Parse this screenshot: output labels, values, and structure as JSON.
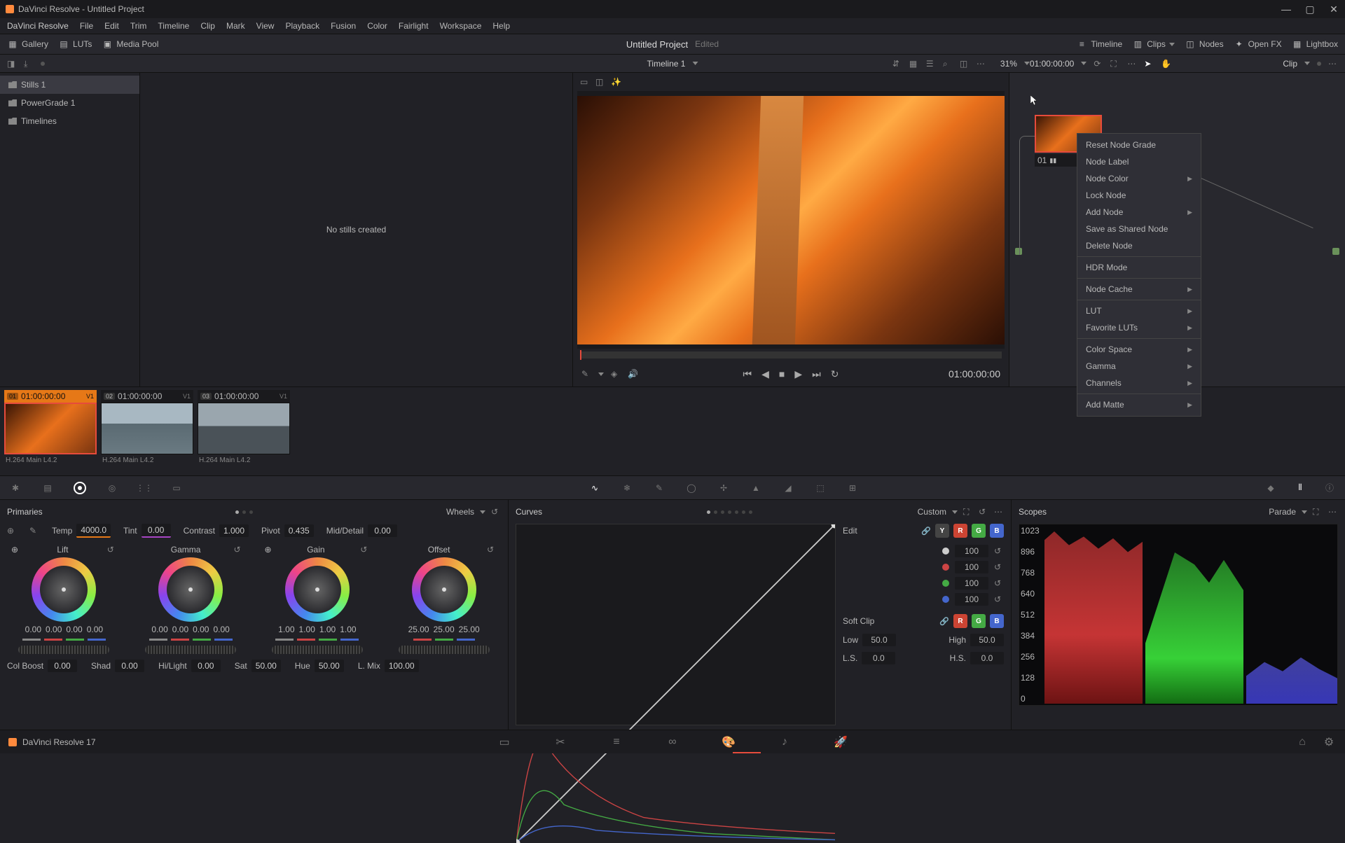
{
  "app": {
    "title": "DaVinci Resolve - Untitled Project",
    "version": "DaVinci Resolve 17"
  },
  "menu": [
    "DaVinci Resolve",
    "File",
    "Edit",
    "Trim",
    "Timeline",
    "Clip",
    "Mark",
    "View",
    "Playback",
    "Fusion",
    "Color",
    "Fairlight",
    "Workspace",
    "Help"
  ],
  "topbar": {
    "gallery": "Gallery",
    "luts": "LUTs",
    "mediapool": "Media Pool",
    "project": "Untitled Project",
    "edited": "Edited",
    "timeline": "Timeline",
    "clips": "Clips",
    "nodes": "Nodes",
    "openfx": "Open FX",
    "lightbox": "Lightbox"
  },
  "secbar": {
    "zoom": "31%",
    "timeline_name": "Timeline 1",
    "timecode": "01:00:00:00",
    "clip_label": "Clip"
  },
  "gallery": {
    "items": [
      "Stills 1",
      "PowerGrade 1",
      "Timelines"
    ],
    "empty": "No stills created"
  },
  "viewer": {
    "timecode": "01:00:00:00"
  },
  "node": {
    "num": "01"
  },
  "context_menu": {
    "reset": "Reset Node Grade",
    "label": "Node Label",
    "color": "Node Color",
    "lock": "Lock Node",
    "add": "Add Node",
    "save_shared": "Save as Shared Node",
    "delete": "Delete Node",
    "hdr": "HDR Mode",
    "cache": "Node Cache",
    "lut": "LUT",
    "fav_luts": "Favorite LUTs",
    "cspace": "Color Space",
    "gamma": "Gamma",
    "channels": "Channels",
    "matte": "Add Matte"
  },
  "clips": [
    {
      "num": "01",
      "tc": "01:00:00:00",
      "track": "V1",
      "codec": "H.264 Main L4.2",
      "selected": true,
      "style": "orange"
    },
    {
      "num": "02",
      "tc": "01:00:00:00",
      "track": "V1",
      "codec": "H.264 Main L4.2",
      "selected": false,
      "style": "lake"
    },
    {
      "num": "03",
      "tc": "01:00:00:00",
      "track": "V1",
      "codec": "H.264 Main L4.2",
      "selected": false,
      "style": "coast"
    }
  ],
  "primaries": {
    "title": "Primaries",
    "mode": "Wheels",
    "temp_l": "Temp",
    "temp": "4000.0",
    "tint_l": "Tint",
    "tint": "0.00",
    "contrast_l": "Contrast",
    "contrast": "1.000",
    "pivot_l": "Pivot",
    "pivot": "0.435",
    "middetail_l": "Mid/Detail",
    "middetail": "0.00",
    "wheels": [
      {
        "name": "Lift",
        "vals": [
          "0.00",
          "0.00",
          "0.00",
          "0.00"
        ]
      },
      {
        "name": "Gamma",
        "vals": [
          "0.00",
          "0.00",
          "0.00",
          "0.00"
        ]
      },
      {
        "name": "Gain",
        "vals": [
          "1.00",
          "1.00",
          "1.00",
          "1.00"
        ]
      },
      {
        "name": "Offset",
        "vals": [
          "25.00",
          "25.00",
          "25.00"
        ]
      }
    ],
    "colboost_l": "Col Boost",
    "colboost": "0.00",
    "shad_l": "Shad",
    "shad": "0.00",
    "hilight_l": "Hi/Light",
    "hilight": "0.00",
    "sat_l": "Sat",
    "sat": "50.00",
    "hue_l": "Hue",
    "hue": "50.00",
    "lmix_l": "L. Mix",
    "lmix": "100.00"
  },
  "curves": {
    "title": "Curves",
    "mode": "Custom",
    "edit": "Edit",
    "y": "Y",
    "r": "R",
    "g": "G",
    "b": "B",
    "intensities": [
      "100",
      "100",
      "100",
      "100"
    ],
    "softclip": "Soft Clip",
    "low_l": "Low",
    "low": "50.0",
    "high_l": "High",
    "high": "50.0",
    "ls_l": "L.S.",
    "ls": "0.0",
    "hs_l": "H.S.",
    "hs": "0.0"
  },
  "scopes": {
    "title": "Scopes",
    "mode": "Parade",
    "ticks": [
      "1023",
      "896",
      "768",
      "640",
      "512",
      "384",
      "256",
      "128",
      "0"
    ]
  }
}
